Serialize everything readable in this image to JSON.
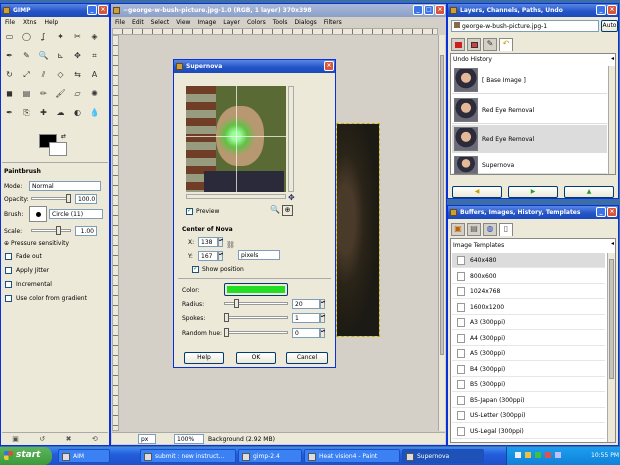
{
  "toolbox": {
    "title": "GIMP",
    "menus": [
      "File",
      "Xtns",
      "Help"
    ],
    "tools": [
      "rect-select-icon",
      "ellipse-select-icon",
      "lasso-icon",
      "wand-icon",
      "scissors-icon",
      "fuzzy-icon",
      "path-icon",
      "color-picker-icon",
      "zoom-icon",
      "measure-icon",
      "move-icon",
      "crop-icon",
      "rotate-icon",
      "scale-icon",
      "shear-icon",
      "perspective-icon",
      "flip-icon",
      "text-icon",
      "bucket-icon",
      "blend-icon",
      "pencil-icon",
      "paintbrush-icon",
      "eraser-icon",
      "airbrush-icon",
      "ink-icon",
      "clone-icon",
      "heal-icon",
      "smudge-icon",
      "dodge-icon",
      "convolve-icon"
    ],
    "options": {
      "title": "Paintbrush",
      "mode_label": "Mode:",
      "mode_value": "Normal",
      "opacity_label": "Opacity:",
      "opacity_value": "100.0",
      "brush_label": "Brush:",
      "brush_value": "Circle (11)",
      "scale_label": "Scale:",
      "scale_value": "1.00",
      "pressure_label": "Pressure sensitivity",
      "fade_label": "Fade out",
      "jitter_label": "Apply Jitter",
      "incremental_label": "Incremental",
      "gradient_label": "Use color from gradient"
    }
  },
  "image_window": {
    "title": "~george-w-bush-picture.jpg-1.0 (RGB, 1 layer) 370x398",
    "menus": [
      "File",
      "Edit",
      "Select",
      "View",
      "Image",
      "Layer",
      "Colors",
      "Tools",
      "Dialogs",
      "Filters"
    ],
    "status": {
      "unit": "px",
      "zoom": "100%",
      "info": "Background (2.92 MB)"
    }
  },
  "dialog": {
    "title": "Supernova",
    "preview_label": "Preview",
    "center_label": "Center of Nova",
    "x_label": "X:",
    "x_value": "138",
    "y_label": "Y:",
    "y_value": "167",
    "unit_value": "pixels",
    "show_position_label": "Show position",
    "color_label": "Color:",
    "nova_color": "#22dd22",
    "radius_label": "Radius:",
    "radius_value": "20",
    "spokes_label": "Spokes:",
    "spokes_value": "1",
    "hue_label": "Random hue:",
    "hue_value": "0",
    "help_label": "Help",
    "ok_label": "OK",
    "cancel_label": "Cancel"
  },
  "layers_dock": {
    "title": "Layers, Channels, Paths, Undo",
    "image_select": "george-w-bush-picture.jpg-1",
    "auto_label": "Auto",
    "undo_header": "Undo History",
    "history": [
      "[ Base Image ]",
      "Red Eye Removal",
      "Red Eye Removal",
      "Supernova"
    ]
  },
  "buffers_dock": {
    "title": "Buffers, Images, History, Templates",
    "templates_header": "Image Templates",
    "templates": [
      "640x480",
      "800x600",
      "1024x768",
      "1600x1200",
      "A3 (300ppi)",
      "A4 (300ppi)",
      "A5 (300ppi)",
      "B4 (300ppi)",
      "B5 (300ppi)",
      "B5-Japan (300ppi)",
      "US-Letter (300ppi)",
      "US-Legal (300ppi)"
    ]
  },
  "taskbar": {
    "start_label": "start",
    "items": [
      "AIM",
      "submit : new instruct...",
      "gimp-2.4",
      "Heat vision4 - Paint",
      "Supernova"
    ],
    "clock": "10:55 PM"
  }
}
